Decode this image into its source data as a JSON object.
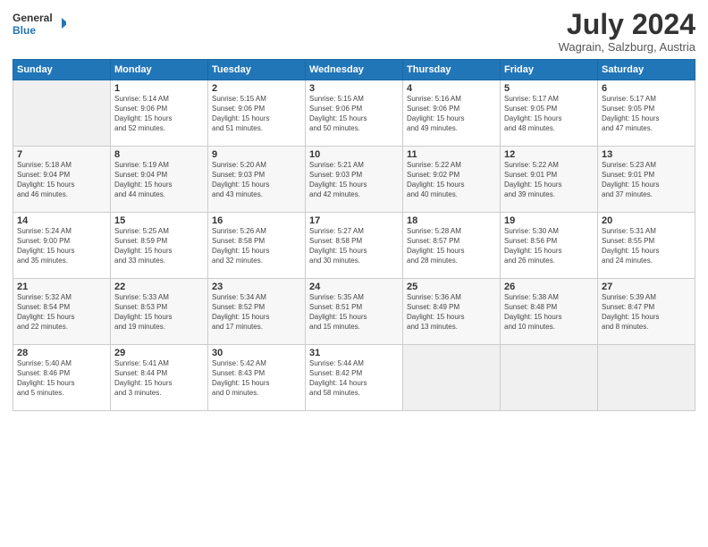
{
  "logo": {
    "line1": "General",
    "line2": "Blue"
  },
  "title": "July 2024",
  "location": "Wagrain, Salzburg, Austria",
  "days_of_week": [
    "Sunday",
    "Monday",
    "Tuesday",
    "Wednesday",
    "Thursday",
    "Friday",
    "Saturday"
  ],
  "weeks": [
    [
      {
        "day": "",
        "info": ""
      },
      {
        "day": "1",
        "info": "Sunrise: 5:14 AM\nSunset: 9:06 PM\nDaylight: 15 hours\nand 52 minutes."
      },
      {
        "day": "2",
        "info": "Sunrise: 5:15 AM\nSunset: 9:06 PM\nDaylight: 15 hours\nand 51 minutes."
      },
      {
        "day": "3",
        "info": "Sunrise: 5:15 AM\nSunset: 9:06 PM\nDaylight: 15 hours\nand 50 minutes."
      },
      {
        "day": "4",
        "info": "Sunrise: 5:16 AM\nSunset: 9:06 PM\nDaylight: 15 hours\nand 49 minutes."
      },
      {
        "day": "5",
        "info": "Sunrise: 5:17 AM\nSunset: 9:05 PM\nDaylight: 15 hours\nand 48 minutes."
      },
      {
        "day": "6",
        "info": "Sunrise: 5:17 AM\nSunset: 9:05 PM\nDaylight: 15 hours\nand 47 minutes."
      }
    ],
    [
      {
        "day": "7",
        "info": "Sunrise: 5:18 AM\nSunset: 9:04 PM\nDaylight: 15 hours\nand 46 minutes."
      },
      {
        "day": "8",
        "info": "Sunrise: 5:19 AM\nSunset: 9:04 PM\nDaylight: 15 hours\nand 44 minutes."
      },
      {
        "day": "9",
        "info": "Sunrise: 5:20 AM\nSunset: 9:03 PM\nDaylight: 15 hours\nand 43 minutes."
      },
      {
        "day": "10",
        "info": "Sunrise: 5:21 AM\nSunset: 9:03 PM\nDaylight: 15 hours\nand 42 minutes."
      },
      {
        "day": "11",
        "info": "Sunrise: 5:22 AM\nSunset: 9:02 PM\nDaylight: 15 hours\nand 40 minutes."
      },
      {
        "day": "12",
        "info": "Sunrise: 5:22 AM\nSunset: 9:01 PM\nDaylight: 15 hours\nand 39 minutes."
      },
      {
        "day": "13",
        "info": "Sunrise: 5:23 AM\nSunset: 9:01 PM\nDaylight: 15 hours\nand 37 minutes."
      }
    ],
    [
      {
        "day": "14",
        "info": "Sunrise: 5:24 AM\nSunset: 9:00 PM\nDaylight: 15 hours\nand 35 minutes."
      },
      {
        "day": "15",
        "info": "Sunrise: 5:25 AM\nSunset: 8:59 PM\nDaylight: 15 hours\nand 33 minutes."
      },
      {
        "day": "16",
        "info": "Sunrise: 5:26 AM\nSunset: 8:58 PM\nDaylight: 15 hours\nand 32 minutes."
      },
      {
        "day": "17",
        "info": "Sunrise: 5:27 AM\nSunset: 8:58 PM\nDaylight: 15 hours\nand 30 minutes."
      },
      {
        "day": "18",
        "info": "Sunrise: 5:28 AM\nSunset: 8:57 PM\nDaylight: 15 hours\nand 28 minutes."
      },
      {
        "day": "19",
        "info": "Sunrise: 5:30 AM\nSunset: 8:56 PM\nDaylight: 15 hours\nand 26 minutes."
      },
      {
        "day": "20",
        "info": "Sunrise: 5:31 AM\nSunset: 8:55 PM\nDaylight: 15 hours\nand 24 minutes."
      }
    ],
    [
      {
        "day": "21",
        "info": "Sunrise: 5:32 AM\nSunset: 8:54 PM\nDaylight: 15 hours\nand 22 minutes."
      },
      {
        "day": "22",
        "info": "Sunrise: 5:33 AM\nSunset: 8:53 PM\nDaylight: 15 hours\nand 19 minutes."
      },
      {
        "day": "23",
        "info": "Sunrise: 5:34 AM\nSunset: 8:52 PM\nDaylight: 15 hours\nand 17 minutes."
      },
      {
        "day": "24",
        "info": "Sunrise: 5:35 AM\nSunset: 8:51 PM\nDaylight: 15 hours\nand 15 minutes."
      },
      {
        "day": "25",
        "info": "Sunrise: 5:36 AM\nSunset: 8:49 PM\nDaylight: 15 hours\nand 13 minutes."
      },
      {
        "day": "26",
        "info": "Sunrise: 5:38 AM\nSunset: 8:48 PM\nDaylight: 15 hours\nand 10 minutes."
      },
      {
        "day": "27",
        "info": "Sunrise: 5:39 AM\nSunset: 8:47 PM\nDaylight: 15 hours\nand 8 minutes."
      }
    ],
    [
      {
        "day": "28",
        "info": "Sunrise: 5:40 AM\nSunset: 8:46 PM\nDaylight: 15 hours\nand 5 minutes."
      },
      {
        "day": "29",
        "info": "Sunrise: 5:41 AM\nSunset: 8:44 PM\nDaylight: 15 hours\nand 3 minutes."
      },
      {
        "day": "30",
        "info": "Sunrise: 5:42 AM\nSunset: 8:43 PM\nDaylight: 15 hours\nand 0 minutes."
      },
      {
        "day": "31",
        "info": "Sunrise: 5:44 AM\nSunset: 8:42 PM\nDaylight: 14 hours\nand 58 minutes."
      },
      {
        "day": "",
        "info": ""
      },
      {
        "day": "",
        "info": ""
      },
      {
        "day": "",
        "info": ""
      }
    ]
  ]
}
